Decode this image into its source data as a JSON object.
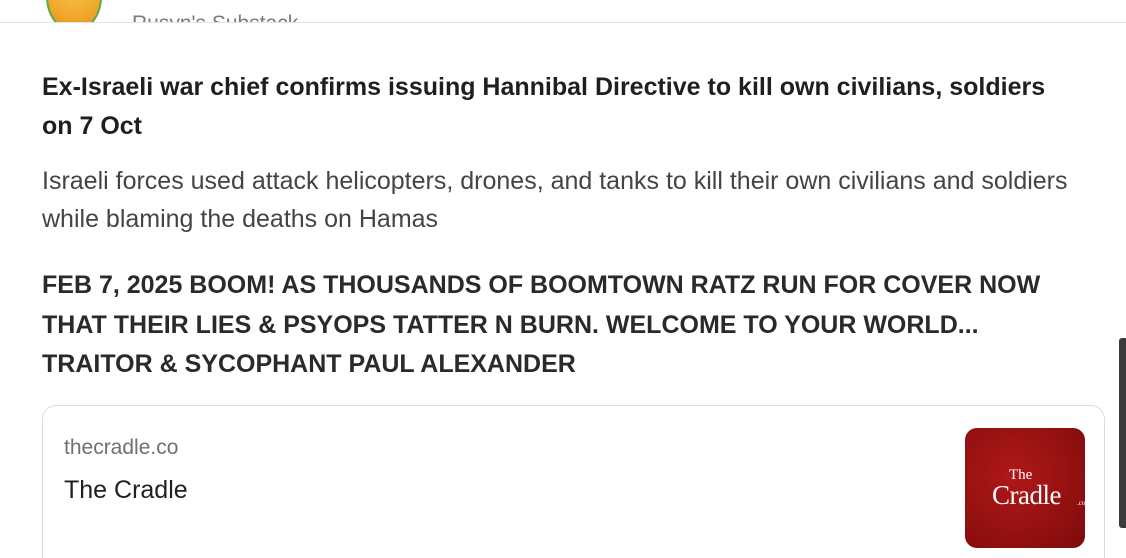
{
  "header": {
    "author_name": "Rusyn's Substack"
  },
  "post": {
    "title": "Ex-Israeli war chief confirms issuing Hannibal Directive to kill own civilians, soldiers on 7 Oct",
    "subtitle": "Israeli forces used attack helicopters, drones, and tanks to kill their own civilians and soldiers while blaming the deaths on Hamas",
    "body": "FEB 7, 2025 BOOM! AS THOUSANDS OF BOOMTOWN RATZ RUN FOR COVER NOW THAT THEIR LIES & PSYOPS TATTER N BURN. WELCOME TO YOUR WORLD... TRAITOR & SYCOPHANT PAUL ALEXANDER"
  },
  "link_card": {
    "domain": "thecradle.co",
    "title": "The Cradle",
    "thumbnail": {
      "line1": "The",
      "line2": "Cradle",
      "suffix": ".co",
      "background_color": "#9b1212"
    }
  },
  "icons": {
    "avatar": "author-avatar",
    "scrollbar": "scrollbar-thumb"
  }
}
